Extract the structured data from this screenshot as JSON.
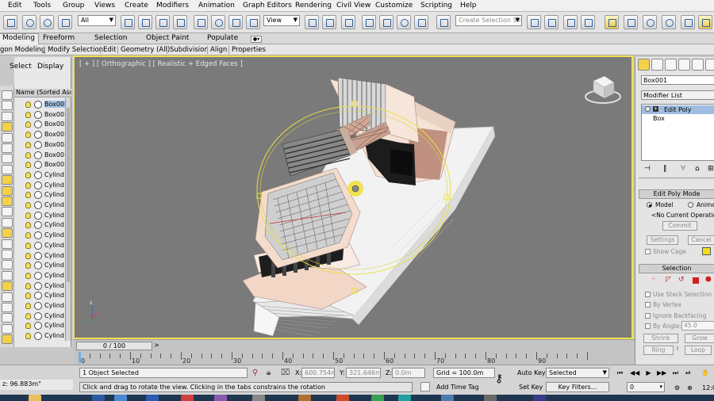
{
  "menu": [
    "Edit",
    "Tools",
    "Group",
    "Views",
    "Create",
    "Modifiers",
    "Animation",
    "Graph Editors",
    "Rendering",
    "Civil View",
    "Customize",
    "Scripting",
    "Help"
  ],
  "toolbar": {
    "selection_filter": "All",
    "coord_system": "View",
    "named_selection_placeholder": "Create Selection Se"
  },
  "ribbon": {
    "tabs": [
      "Modeling",
      "Freeform",
      "Selection",
      "Object Paint",
      "Populate"
    ],
    "subtabs": [
      "gon Modeling",
      "Modify Selection",
      "Edit",
      "Geometry (All)",
      "Subdivision",
      "Align",
      "Properties"
    ]
  },
  "explorer": {
    "tabs": [
      "Select",
      "Display"
    ],
    "column_header": "Name (Sorted Ascen",
    "items": [
      "Box00",
      "Box00",
      "Box00",
      "Box00",
      "Box00",
      "Box00",
      "Box00",
      "Cylind",
      "Cylind",
      "Cylind",
      "Cylind",
      "Cylind",
      "Cylind",
      "Cylind",
      "Cylind",
      "Cylind",
      "Cylind",
      "Cylind",
      "Cylind",
      "Cylind",
      "Cylind",
      "Cylind",
      "Cylind",
      "Cylind"
    ]
  },
  "viewport": {
    "label": "[ + ] [ Orthographic ] [ Realistic + Edged Faces ]"
  },
  "timeline": {
    "slider": "0 / 100",
    "ruler_labels": [
      "0",
      "10",
      "20",
      "30",
      "40",
      "50",
      "60",
      "70",
      "80",
      "90"
    ]
  },
  "status": {
    "left_coord": "z: 96.883m\"",
    "selected_count": "1 Object Selected",
    "prompt": "Click and drag to rotate the view.  Clicking in the tabs constrains the rotation",
    "x_label": "X:",
    "x_value": "600.754m",
    "y_label": "Y:",
    "y_value": "321.646m",
    "z_label": "Z:",
    "z_value": "0.0m",
    "grid": "Grid = 100.0m",
    "add_time_tag": "Add Time Tag",
    "auto_key": "Auto Key",
    "set_key": "Set Key",
    "key_mode": "Selected",
    "key_filters": "Key Filters...",
    "frame": "0",
    "clock": "12:0"
  },
  "command_panel": {
    "object_name": "Box001",
    "modifier_list": "Modifier List",
    "stack": [
      "Edit Poly",
      "Box"
    ],
    "edit_poly_mode": {
      "title": "Edit Poly Mode",
      "model": "Model",
      "animate": "Animat",
      "no_op": "<No Current Operation>",
      "commit": "Commit",
      "settings": "Settings",
      "cancel": "Cancel",
      "show_cage": "Show Cage"
    },
    "selection": {
      "title": "Selection",
      "use_stack": "Use Stack Selection",
      "by_vertex": "By Vertex",
      "ignore_backfacing": "Ignore Backfacing",
      "by_angle": "By Angle:",
      "angle_value": "45.0",
      "shrink": "Shrink",
      "grow": "Grow",
      "ring": "Ring",
      "loop": "Loop"
    }
  },
  "colors": {
    "viewport_bg": "#7a7a7a",
    "active_border": "#f0e050",
    "gizmo": "#e8e040"
  }
}
